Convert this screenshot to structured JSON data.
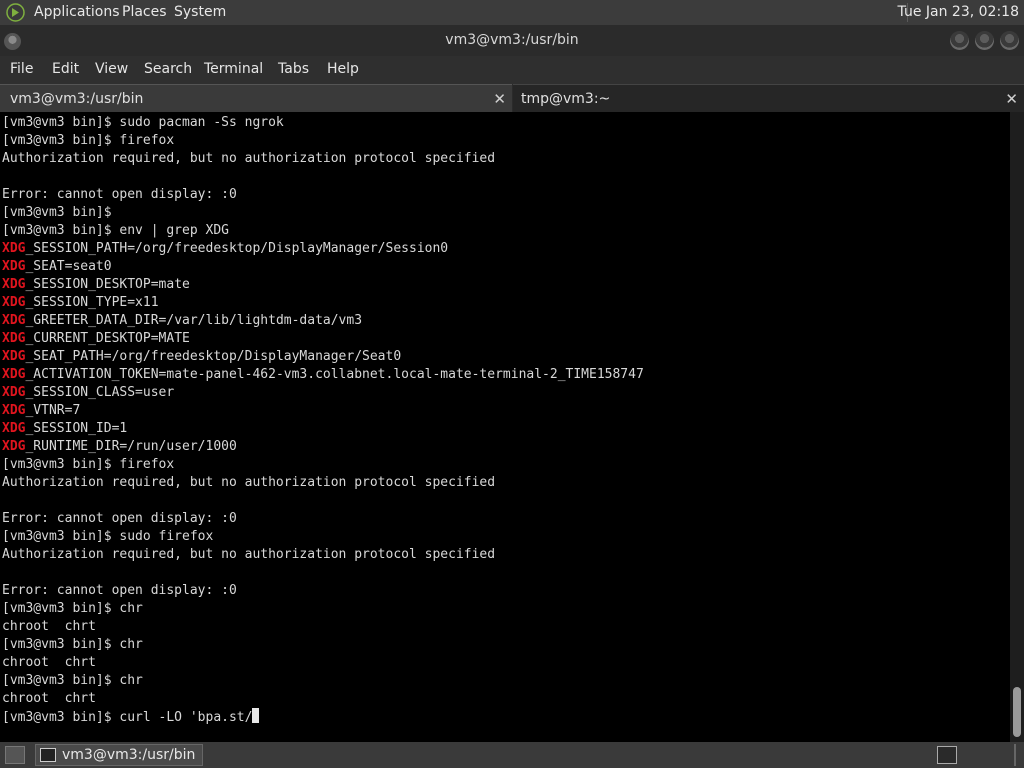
{
  "top_panel": {
    "menus": [
      "Applications",
      "Places",
      "System"
    ],
    "clock": "Tue Jan 23, 02:18",
    "logo_icon": "mate-logo-icon"
  },
  "window": {
    "title": "vm3@vm3:/usr/bin"
  },
  "menubar": {
    "items": [
      "File",
      "Edit",
      "View",
      "Search",
      "Terminal",
      "Tabs",
      "Help"
    ]
  },
  "tabs": [
    {
      "label": "vm3@vm3:/usr/bin",
      "close": "✕",
      "active": true
    },
    {
      "label": "tmp@vm3:~",
      "close": "✕",
      "active": false
    }
  ],
  "terminal": {
    "lines": [
      {
        "text": "[vm3@vm3 bin]$ sudo pacman -Ss ngrok"
      },
      {
        "text": "[vm3@vm3 bin]$ firefox"
      },
      {
        "text": "Authorization required, but no authorization protocol specified"
      },
      {
        "text": ""
      },
      {
        "text": "Error: cannot open display: :0"
      },
      {
        "text": "[vm3@vm3 bin]$"
      },
      {
        "text": "[vm3@vm3 bin]$ env | grep XDG"
      },
      {
        "hl": "XDG",
        "text": "_SESSION_PATH=/org/freedesktop/DisplayManager/Session0"
      },
      {
        "hl": "XDG",
        "text": "_SEAT=seat0"
      },
      {
        "hl": "XDG",
        "text": "_SESSION_DESKTOP=mate"
      },
      {
        "hl": "XDG",
        "text": "_SESSION_TYPE=x11"
      },
      {
        "hl": "XDG",
        "text": "_GREETER_DATA_DIR=/var/lib/lightdm-data/vm3"
      },
      {
        "hl": "XDG",
        "text": "_CURRENT_DESKTOP=MATE"
      },
      {
        "hl": "XDG",
        "text": "_SEAT_PATH=/org/freedesktop/DisplayManager/Seat0"
      },
      {
        "hl": "XDG",
        "text": "_ACTIVATION_TOKEN=mate-panel-462-vm3.collabnet.local-mate-terminal-2_TIME158747"
      },
      {
        "hl": "XDG",
        "text": "_SESSION_CLASS=user"
      },
      {
        "hl": "XDG",
        "text": "_VTNR=7"
      },
      {
        "hl": "XDG",
        "text": "_SESSION_ID=1"
      },
      {
        "hl": "XDG",
        "text": "_RUNTIME_DIR=/run/user/1000"
      },
      {
        "text": "[vm3@vm3 bin]$ firefox"
      },
      {
        "text": "Authorization required, but no authorization protocol specified"
      },
      {
        "text": ""
      },
      {
        "text": "Error: cannot open display: :0"
      },
      {
        "text": "[vm3@vm3 bin]$ sudo firefox"
      },
      {
        "text": "Authorization required, but no authorization protocol specified"
      },
      {
        "text": ""
      },
      {
        "text": "Error: cannot open display: :0"
      },
      {
        "text": "[vm3@vm3 bin]$ chr"
      },
      {
        "text": "chroot  chrt"
      },
      {
        "text": "[vm3@vm3 bin]$ chr"
      },
      {
        "text": "chroot  chrt"
      },
      {
        "text": "[vm3@vm3 bin]$ chr"
      },
      {
        "text": "chroot  chrt"
      },
      {
        "text": "[vm3@vm3 bin]$ curl -LO 'bpa.st/",
        "cursor": true
      }
    ]
  },
  "bottom_panel": {
    "task_label": "vm3@vm3:/usr/bin"
  },
  "colors": {
    "highlight": "#e0141e",
    "terminal_bg": "#000000",
    "terminal_fg": "#d8d8d8"
  }
}
